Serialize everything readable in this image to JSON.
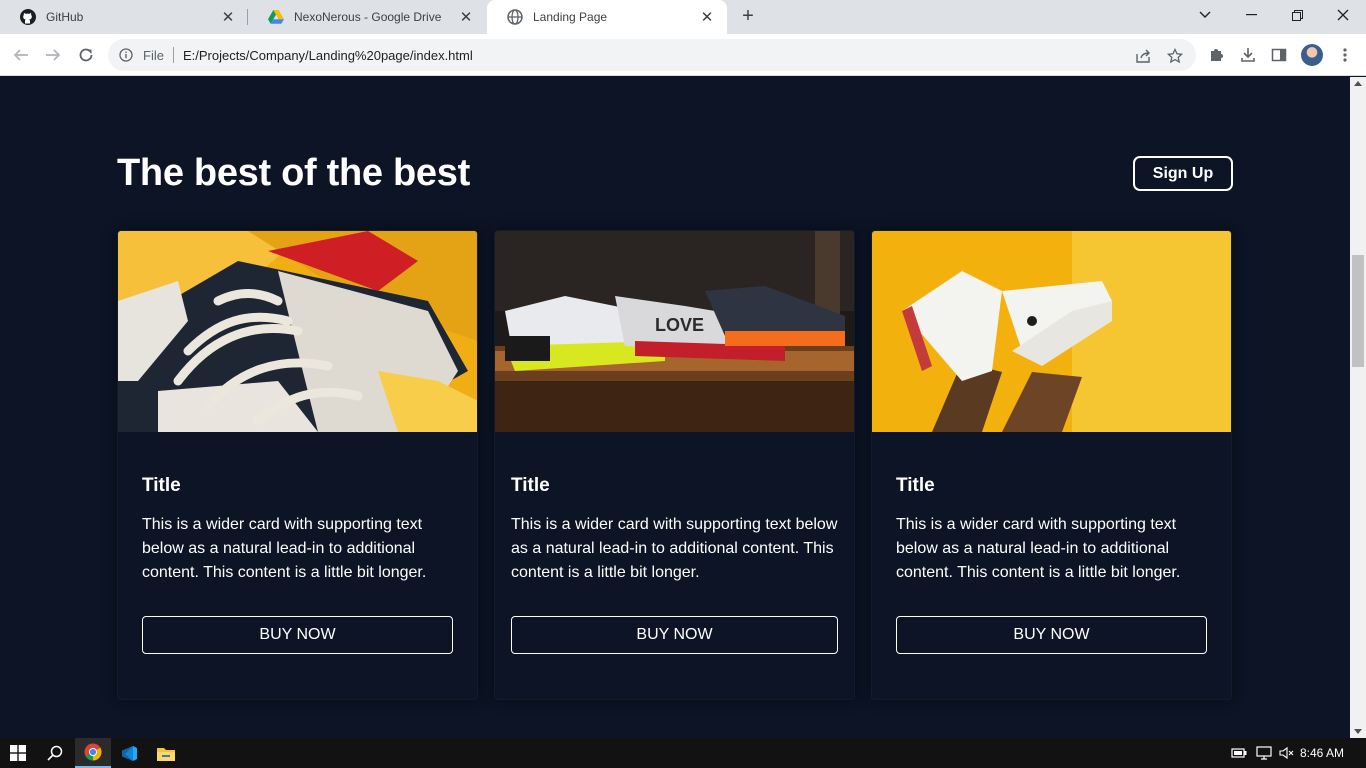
{
  "browser": {
    "tabs": [
      {
        "title": "GitHub",
        "icon": "github-icon",
        "active": false
      },
      {
        "title": "NexoNerous - Google Drive",
        "icon": "google-drive-icon",
        "active": false
      },
      {
        "title": "Landing Page",
        "icon": "globe-icon",
        "active": true
      }
    ],
    "address": {
      "scheme_label": "File",
      "url": "E:/Projects/Company/Landing%20page/index.html"
    }
  },
  "page": {
    "section_title": "The best of the best",
    "signup_label": "Sign Up",
    "cards": [
      {
        "title": "Title",
        "text": "This is a wider card with supporting text below as a natural lead-in to additional content. This content is a little bit longer.",
        "button": "BUY NOW",
        "image": "sneakers-closeup-yellow-photo"
      },
      {
        "title": "Title",
        "text": "This is a wider card with supporting text below as a natural lead-in to additional content. This content is a little bit longer.",
        "button": "BUY NOW",
        "image": "sneakers-on-shelf-photo"
      },
      {
        "title": "Title",
        "text": "This is a wider card with supporting text below as a natural lead-in to additional content. This content is a little bit longer.",
        "button": "BUY NOW",
        "image": "white-sneakers-on-yellow-wall-photo"
      }
    ]
  },
  "taskbar": {
    "apps": [
      "windows-start-icon",
      "search-icon",
      "chrome-icon",
      "vscode-icon",
      "file-explorer-icon"
    ],
    "time": "8:46 AM"
  },
  "colors": {
    "page_bg": "#0c1425",
    "text": "#ffffff",
    "tabstrip": "#dee1e6"
  }
}
